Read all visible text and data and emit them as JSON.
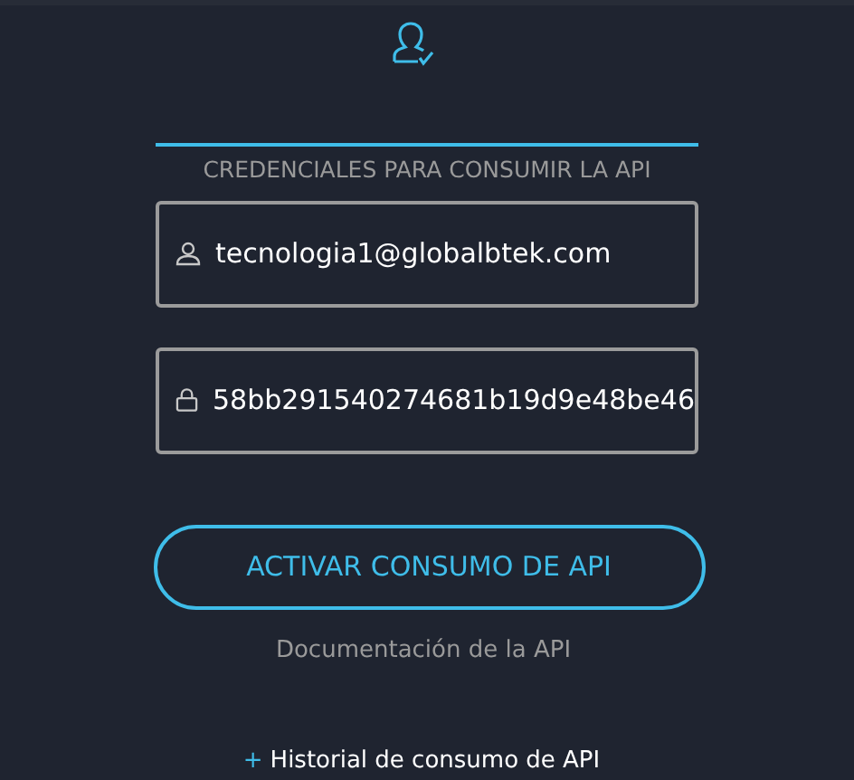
{
  "section_title": "CREDENCIALES PARA CONSUMIR LA API",
  "fields": [
    {
      "kind": "user",
      "value": "tecnologia1@globalbtek.com"
    },
    {
      "kind": "lock",
      "value": "58bb291540274681b19d9e48be46"
    }
  ],
  "primary_button": "ACTIVAR CONSUMO DE API",
  "docs_link": "Documentación de la API",
  "history_link": {
    "prefix": "+",
    "label": "Historial de consumo de API"
  }
}
